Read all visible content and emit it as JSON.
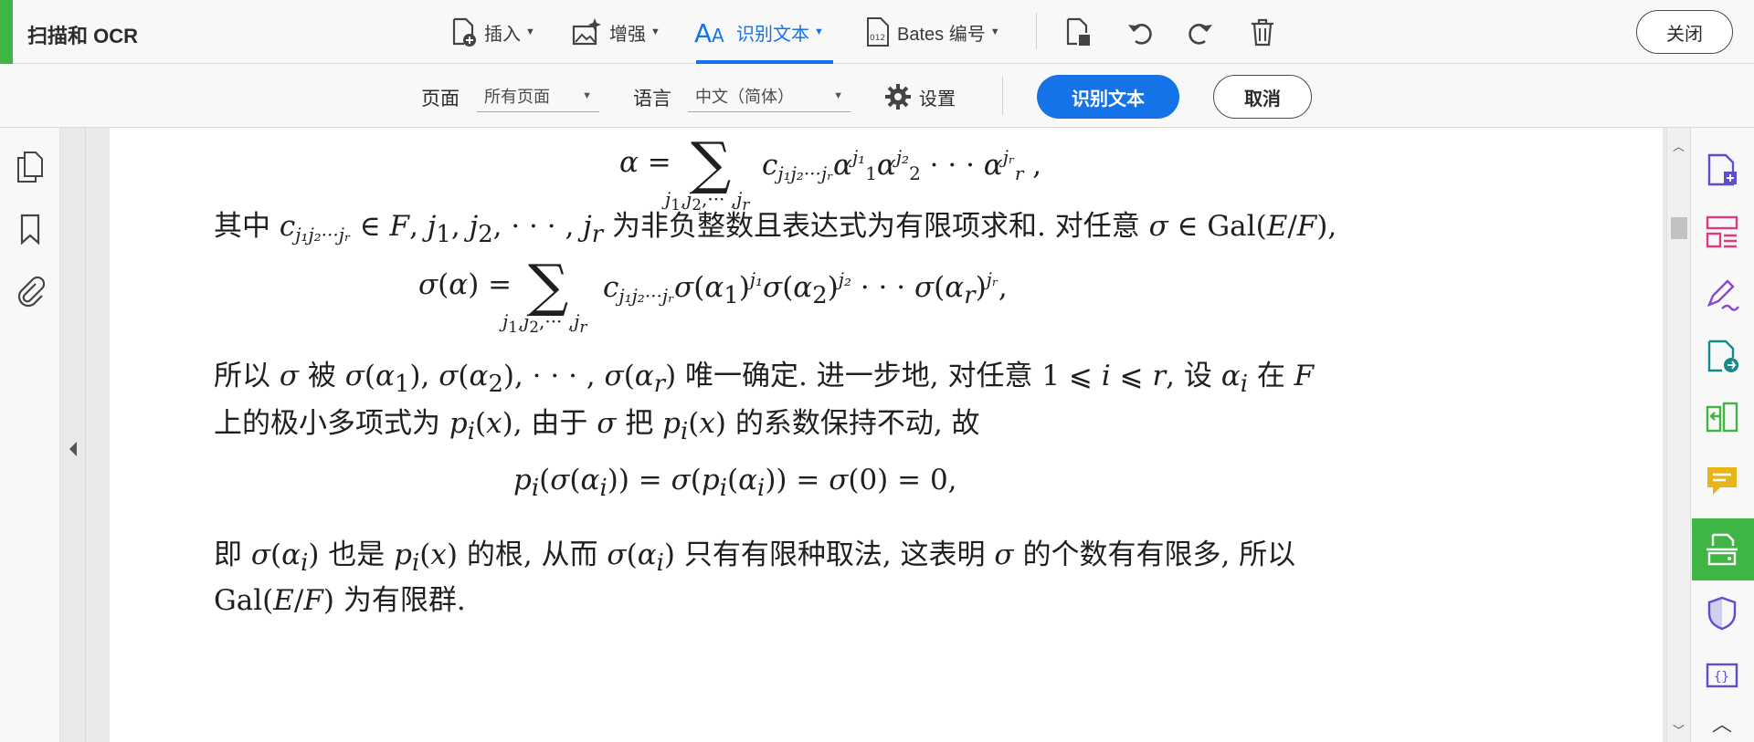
{
  "toolbar": {
    "title": "扫描和 OCR",
    "insert_label": "插入",
    "enhance_label": "增强",
    "recognize_label": "识别文本",
    "bates_label": "Bates 编号",
    "close_label": "关闭"
  },
  "subbar": {
    "pages_label": "页面",
    "pages_value": "所有页面",
    "language_label": "语言",
    "language_value": "中文（简体）",
    "settings_label": "设置",
    "recognize_button": "识别文本",
    "cancel_button": "取消"
  },
  "document": {
    "line1_pre": "其中",
    "line1_mid": "为非负整数且表达式为有限项求和. 对任意",
    "line2_pre": "所以",
    "line2_a": "被",
    "line2_b": "唯一确定. 进一步地, 对任意",
    "line2_c": ", 设",
    "line2_d": "在",
    "line3_a": "上的极小多项式为",
    "line3_b": ", 由于",
    "line3_c": "把",
    "line3_d": "的系数保持不动, 故",
    "line4_a": "即",
    "line4_b": "也是",
    "line4_c": "的根, 从而",
    "line4_d": "只有有限种取法, 这表明",
    "line4_e": "的个数有有限多, 所以",
    "line5_a": "为有限群."
  },
  "colors": {
    "accent": "#1473e6",
    "active_tool": "#3fb543"
  },
  "icons": {
    "left_nav": [
      "page-thumbnails-icon",
      "bookmark-icon",
      "attachment-icon"
    ],
    "right_panel": [
      "create-pdf-icon",
      "organize-pages-icon",
      "fill-sign-icon",
      "export-pdf-icon",
      "compare-files-icon",
      "comment-icon",
      "scan-ocr-icon",
      "protect-icon",
      "more-tools-icon"
    ]
  }
}
